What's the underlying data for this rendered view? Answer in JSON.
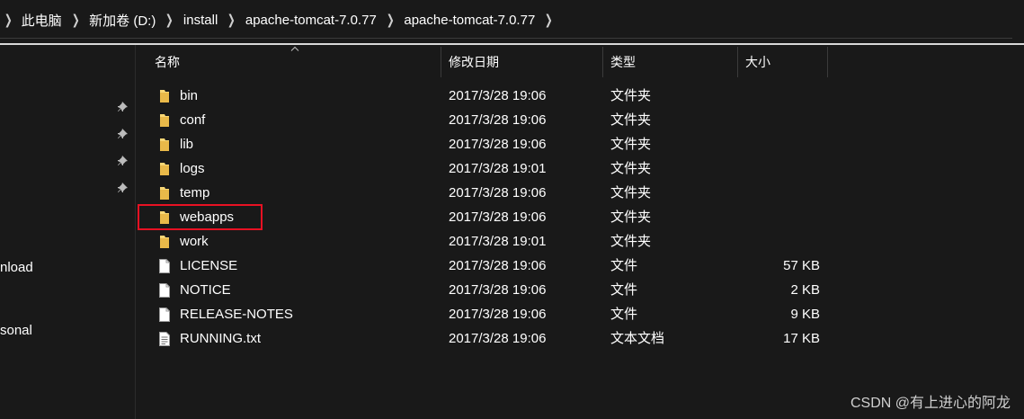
{
  "breadcrumb": {
    "items": [
      "此电脑",
      "新加卷 (D:)",
      "install",
      "apache-tomcat-7.0.77",
      "apache-tomcat-7.0.77"
    ]
  },
  "nav_pane": {
    "items": [
      "nload",
      "sonal"
    ]
  },
  "columns": {
    "name": "名称",
    "modified": "修改日期",
    "type": "类型",
    "size": "大小"
  },
  "files": [
    {
      "name": "bin",
      "modified": "2017/3/28 19:06",
      "type": "文件夹",
      "size": "",
      "icon": "folder-icon"
    },
    {
      "name": "conf",
      "modified": "2017/3/28 19:06",
      "type": "文件夹",
      "size": "",
      "icon": "folder-icon"
    },
    {
      "name": "lib",
      "modified": "2017/3/28 19:06",
      "type": "文件夹",
      "size": "",
      "icon": "folder-icon"
    },
    {
      "name": "logs",
      "modified": "2017/3/28 19:01",
      "type": "文件夹",
      "size": "",
      "icon": "folder-icon"
    },
    {
      "name": "temp",
      "modified": "2017/3/28 19:06",
      "type": "文件夹",
      "size": "",
      "icon": "folder-icon"
    },
    {
      "name": "webapps",
      "modified": "2017/3/28 19:06",
      "type": "文件夹",
      "size": "",
      "icon": "folder-icon",
      "highlighted": true
    },
    {
      "name": "work",
      "modified": "2017/3/28 19:01",
      "type": "文件夹",
      "size": "",
      "icon": "folder-icon"
    },
    {
      "name": "LICENSE",
      "modified": "2017/3/28 19:06",
      "type": "文件",
      "size": "57 KB",
      "icon": "file-icon"
    },
    {
      "name": "NOTICE",
      "modified": "2017/3/28 19:06",
      "type": "文件",
      "size": "2 KB",
      "icon": "file-icon"
    },
    {
      "name": "RELEASE-NOTES",
      "modified": "2017/3/28 19:06",
      "type": "文件",
      "size": "9 KB",
      "icon": "file-icon"
    },
    {
      "name": "RUNNING.txt",
      "modified": "2017/3/28 19:06",
      "type": "文本文档",
      "size": "17 KB",
      "icon": "text-file-icon"
    }
  ],
  "watermark": "CSDN @有上进心的阿龙",
  "colors": {
    "background": "#191919",
    "folder": "#f8d775",
    "highlight_border": "#e81123"
  }
}
